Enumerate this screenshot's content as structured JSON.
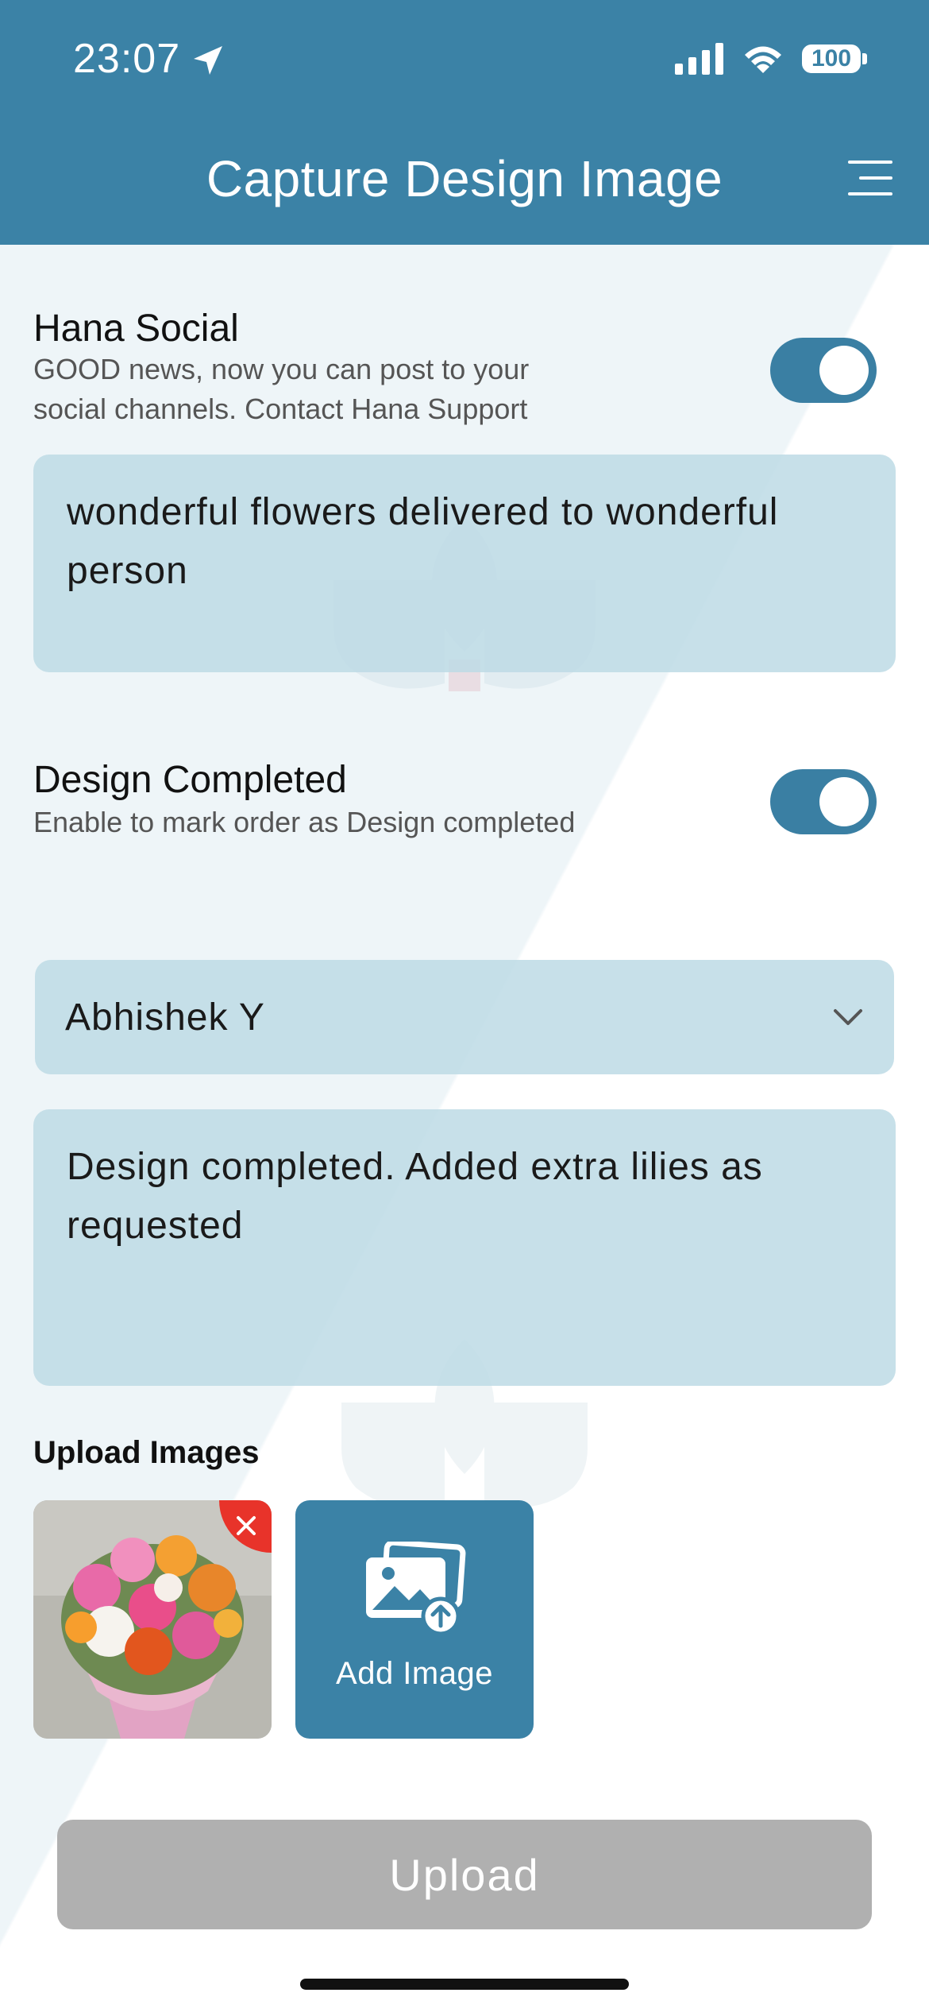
{
  "status_bar": {
    "time": "23:07",
    "battery": "100",
    "icons": [
      "location-arrow-icon",
      "signal-icon",
      "wifi-icon",
      "battery-icon"
    ]
  },
  "header": {
    "title": "Capture Design Image",
    "menu_icon": "menu-icon"
  },
  "hana_social": {
    "title": "Hana Social",
    "description": "GOOD news, now you can post to your social channels. Contact Hana Support",
    "toggle_on": true,
    "post_text": "wonderful flowers delivered to wonderful person"
  },
  "design_completed": {
    "title": "Design Completed",
    "description": "Enable to mark order as Design completed",
    "toggle_on": true
  },
  "designer_select": {
    "selected": "Abhishek Y",
    "icon": "chevron-down-icon"
  },
  "notes": {
    "text": "Design completed. Added extra lilies as requested"
  },
  "upload_images": {
    "label": "Upload Images",
    "add_image_label": "Add Image",
    "remove_icon": "close-icon"
  },
  "upload_button": {
    "label": "Upload"
  },
  "colors": {
    "primary": "#3b82a6",
    "field_bg": "#bddbe5",
    "remove_red": "#e8332a",
    "disabled_gray": "#b0b0b0"
  }
}
